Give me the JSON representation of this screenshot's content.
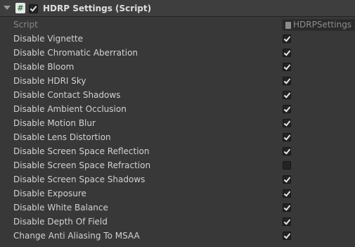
{
  "component": {
    "title": "HDRP Settings (Script)",
    "enabled": true,
    "expanded": true,
    "icon": "script-hash-icon"
  },
  "script_field": {
    "label": "Script",
    "value": "HDRPSettings",
    "icon": "script-file-icon"
  },
  "properties": [
    {
      "label": "Disable Vignette",
      "checked": true
    },
    {
      "label": "Disable Chromatic Aberration",
      "checked": true
    },
    {
      "label": "Disable Bloom",
      "checked": true
    },
    {
      "label": "Disable HDRI Sky",
      "checked": true
    },
    {
      "label": "Disable Contact Shadows",
      "checked": true
    },
    {
      "label": "Disable Ambient Occlusion",
      "checked": true
    },
    {
      "label": "Disable Motion Blur",
      "checked": true
    },
    {
      "label": "Disable Lens Distortion",
      "checked": true
    },
    {
      "label": "Disable Screen Space Reflection",
      "checked": true
    },
    {
      "label": "Disable Screen Space Refraction",
      "checked": false
    },
    {
      "label": "Disable Screen Space Shadows",
      "checked": true
    },
    {
      "label": "Disable Exposure",
      "checked": true
    },
    {
      "label": "Disable White Balance",
      "checked": true
    },
    {
      "label": "Disable Depth Of Field",
      "checked": true
    },
    {
      "label": "Change Anti Aliasing To MSAA",
      "checked": true
    }
  ],
  "colors": {
    "background": "#383838",
    "header": "#3e3e3e",
    "text": "#d2d2d2",
    "checkbox": "#232323"
  }
}
